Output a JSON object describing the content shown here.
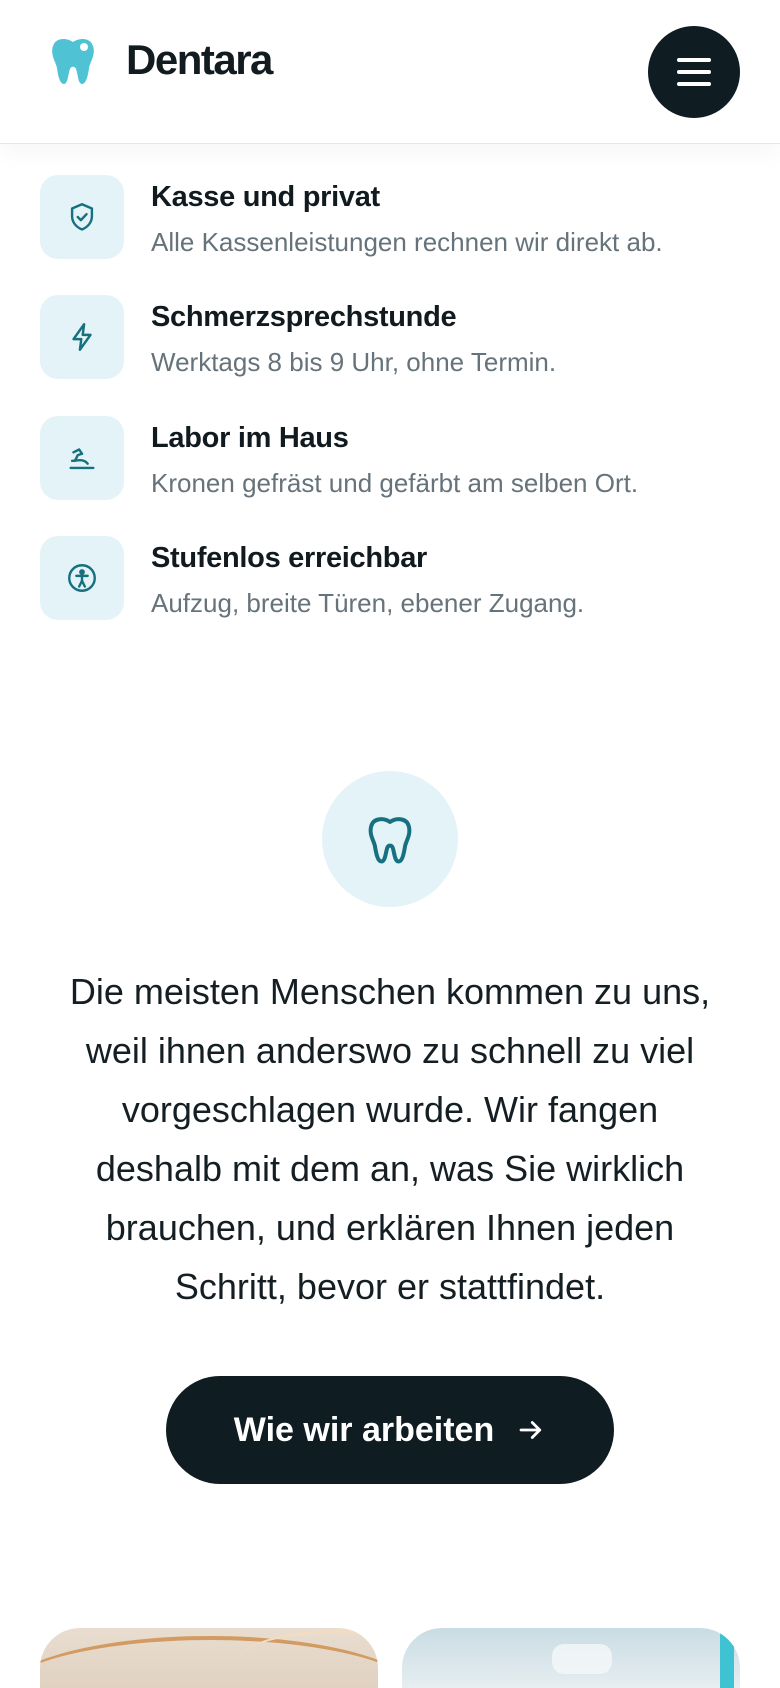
{
  "brand": {
    "name": "Dentara",
    "icon": "tooth-icon",
    "accent_color": "#4fc3d4"
  },
  "header": {
    "menu_button_icon": "hamburger-menu-icon"
  },
  "features": [
    {
      "icon": "shield-check-icon",
      "title": "Kasse und privat",
      "description": "Alle Kassenleistungen rechnen wir direkt ab."
    },
    {
      "icon": "lightning-icon",
      "title": "Schmerzsprechstunde",
      "description": "Werktags 8 bis 9 Uhr, ohne Termin."
    },
    {
      "icon": "dental-chair-icon",
      "title": "Labor im Haus",
      "description": "Kronen gefräst und gefärbt am selben Ort."
    },
    {
      "icon": "accessibility-icon",
      "title": "Stufenlos erreichbar",
      "description": "Aufzug, breite Türen, ebener Zugang."
    }
  ],
  "statement": {
    "icon": "tooth-outline-icon",
    "text": "Die meisten Menschen kommen zu uns, weil ihnen anderswo zu schnell zu viel vorgeschlagen wurde. Wir fangen deshalb mit dem an, was Sie wirklich brauchen, und erklären Ihnen jeden Schritt, bevor er stattfindet."
  },
  "cta": {
    "label": "Wie wir arbeiten",
    "icon": "arrow-right-icon"
  },
  "colors": {
    "dark": "#0f1c21",
    "icon_bg": "#e3f3f7",
    "icon_stroke": "#17707f",
    "muted_text": "#66737a"
  }
}
